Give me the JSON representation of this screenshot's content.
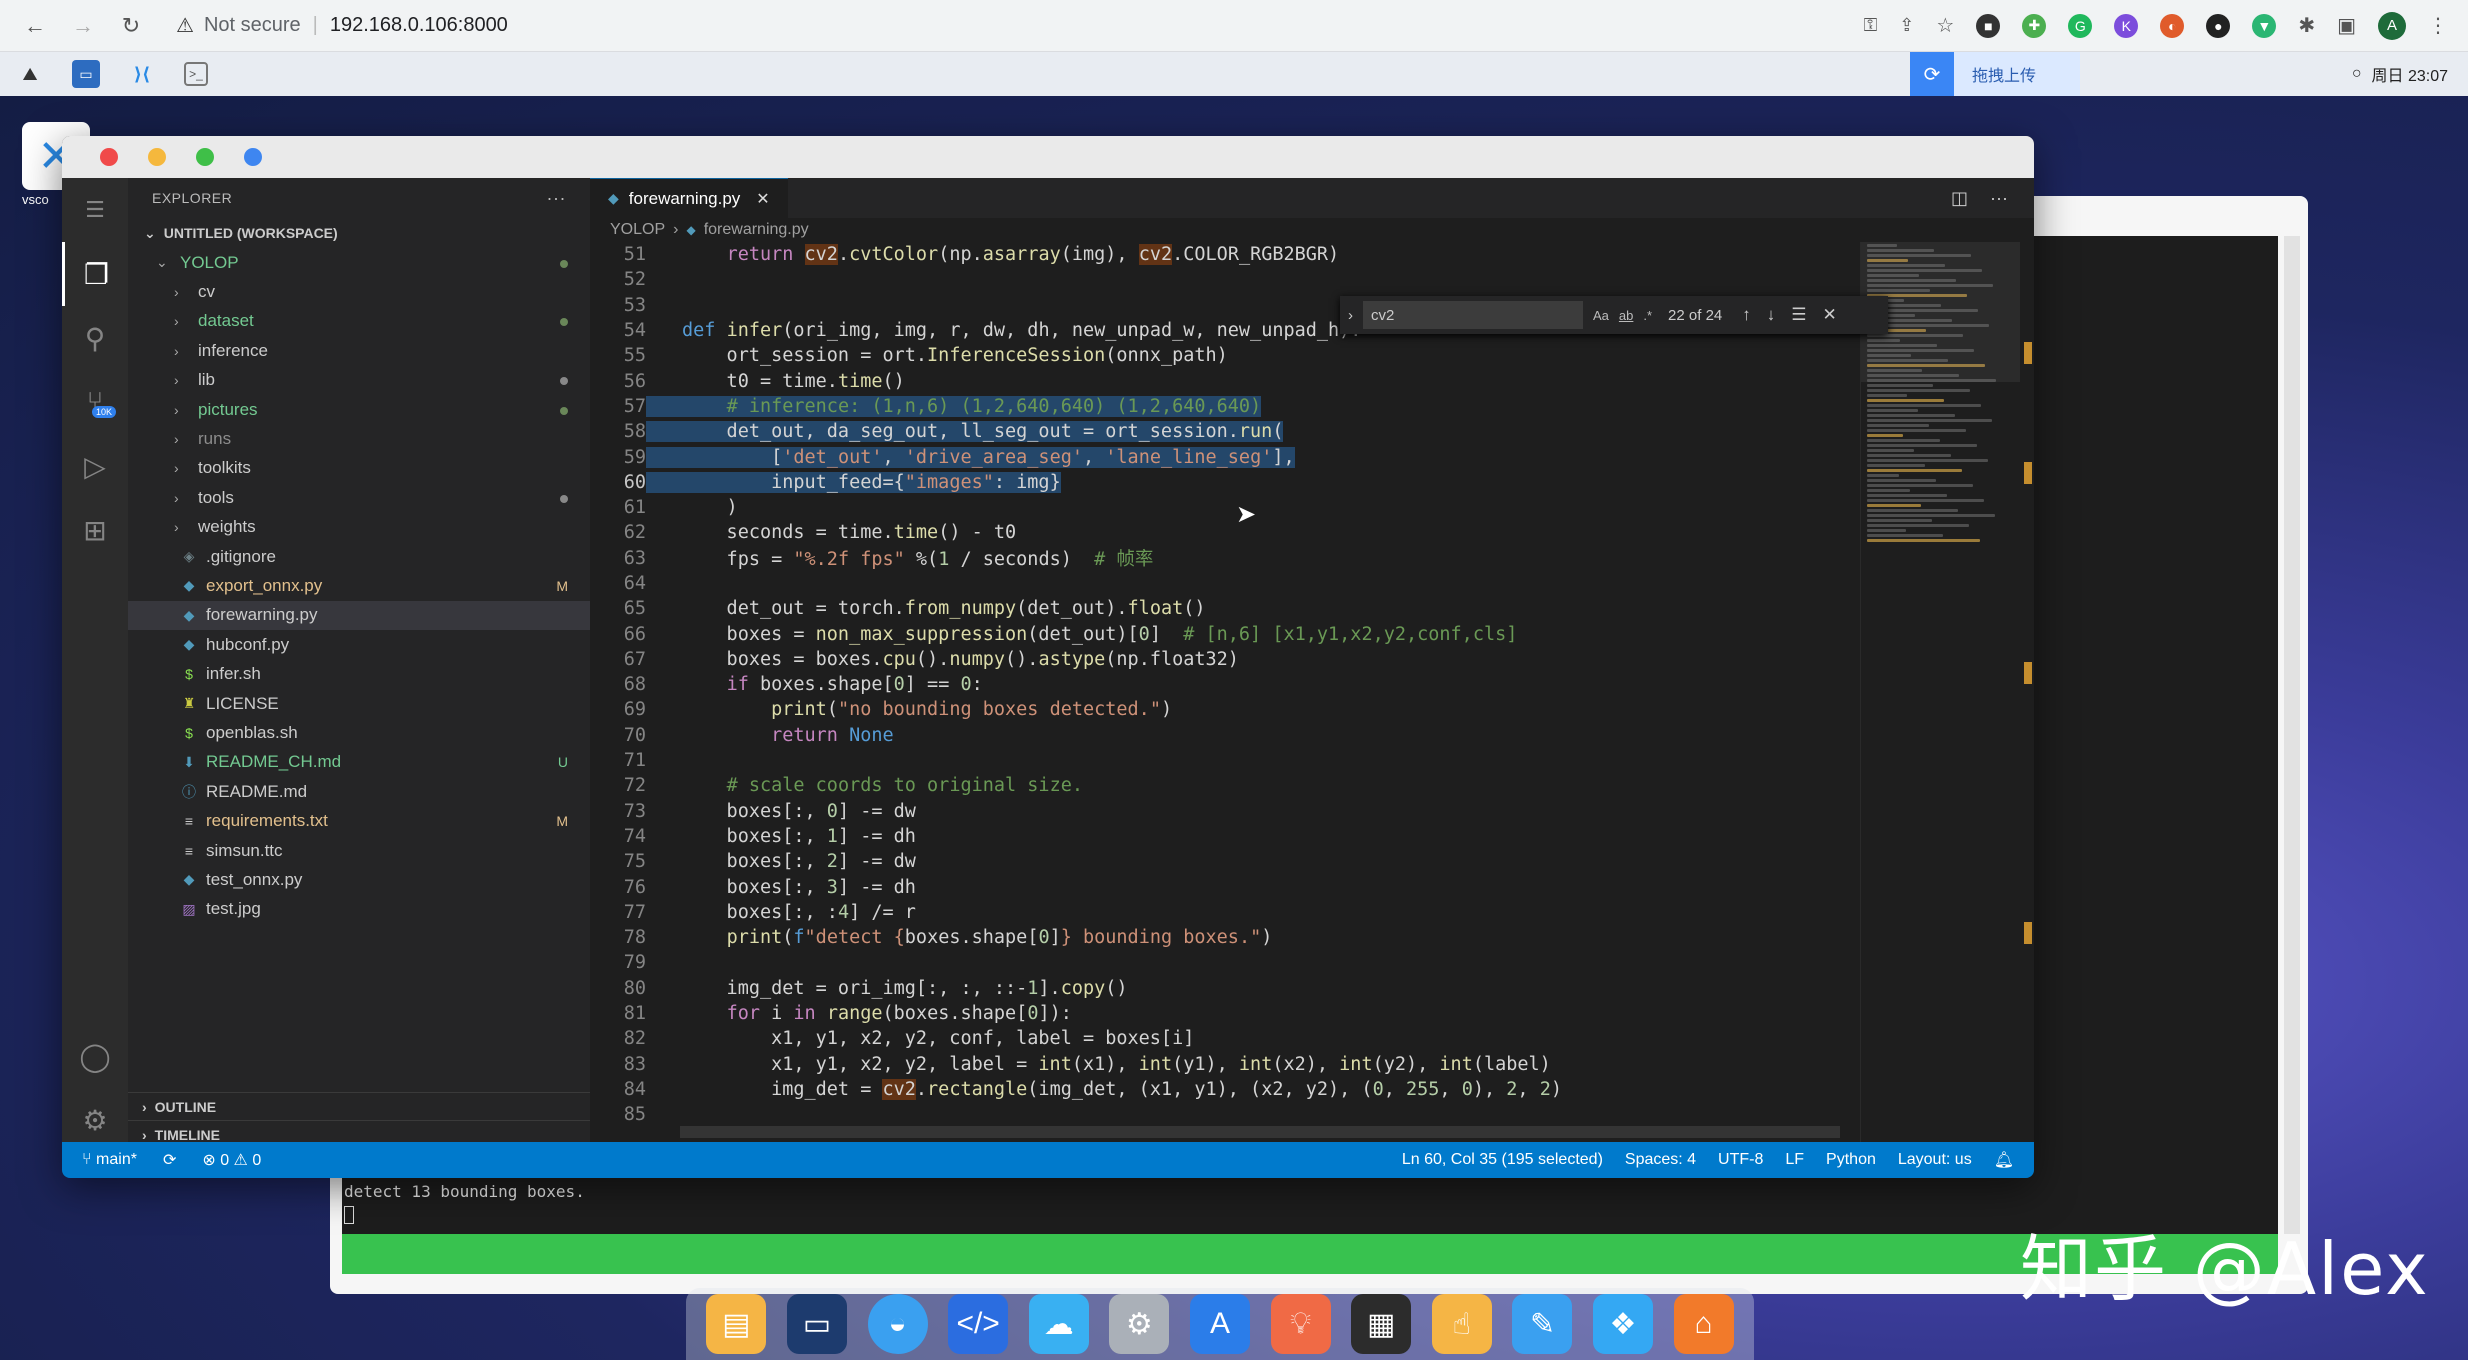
{
  "browser": {
    "security_label": "Not secure",
    "url": "192.168.0.106:8000",
    "avatar_letter": "A"
  },
  "desktop": {
    "upload_label": "拖拽上传",
    "clock": "周日 23:07",
    "vscode_icon_label": "vsco",
    "watermark": "知乎 @Alex"
  },
  "vscode": {
    "explorer_title": "EXPLORER",
    "workspace": "UNTITLED (WORKSPACE)",
    "root_folder": "YOLOP",
    "tree": [
      {
        "name": "cv",
        "type": "folder",
        "status": ""
      },
      {
        "name": "dataset",
        "type": "folder",
        "status": "dot",
        "color": "#73c991"
      },
      {
        "name": "inference",
        "type": "folder",
        "status": ""
      },
      {
        "name": "lib",
        "type": "folder",
        "status": "dotgray"
      },
      {
        "name": "pictures",
        "type": "folder",
        "status": "dot",
        "color": "#73c991"
      },
      {
        "name": "runs",
        "type": "folder",
        "status": "",
        "color": "#8c8c8c"
      },
      {
        "name": "toolkits",
        "type": "folder",
        "status": ""
      },
      {
        "name": "tools",
        "type": "folder",
        "status": "dotgray"
      },
      {
        "name": "weights",
        "type": "folder",
        "status": ""
      },
      {
        "name": ".gitignore",
        "type": "file",
        "icon": "◈",
        "icon_color": "#6d8086",
        "status": ""
      },
      {
        "name": "export_onnx.py",
        "type": "file",
        "icon": "◆",
        "icon_color": "#519aba",
        "status": "M",
        "color": "#e2c08d"
      },
      {
        "name": "forewarning.py",
        "type": "file",
        "icon": "◆",
        "icon_color": "#519aba",
        "status": "",
        "selected": true
      },
      {
        "name": "hubconf.py",
        "type": "file",
        "icon": "◆",
        "icon_color": "#519aba",
        "status": ""
      },
      {
        "name": "infer.sh",
        "type": "file",
        "icon": "$",
        "icon_color": "#89e051",
        "status": ""
      },
      {
        "name": "LICENSE",
        "type": "file",
        "icon": "♜",
        "icon_color": "#cbcb41",
        "status": ""
      },
      {
        "name": "openblas.sh",
        "type": "file",
        "icon": "$",
        "icon_color": "#89e051",
        "status": ""
      },
      {
        "name": "README_CH.md",
        "type": "file",
        "icon": "⬇",
        "icon_color": "#519aba",
        "status": "U",
        "color": "#73c991"
      },
      {
        "name": "README.md",
        "type": "file",
        "icon": "ⓘ",
        "icon_color": "#519aba",
        "status": ""
      },
      {
        "name": "requirements.txt",
        "type": "file",
        "icon": "≡",
        "icon_color": "#cccccc",
        "status": "M",
        "color": "#e2c08d"
      },
      {
        "name": "simsun.ttc",
        "type": "file",
        "icon": "≡",
        "icon_color": "#cccccc",
        "status": ""
      },
      {
        "name": "test_onnx.py",
        "type": "file",
        "icon": "◆",
        "icon_color": "#519aba",
        "status": ""
      },
      {
        "name": "test.jpg",
        "type": "file",
        "icon": "▨",
        "icon_color": "#a074c4",
        "status": ""
      }
    ],
    "outline_label": "OUTLINE",
    "timeline_label": "TIMELINE",
    "activity_badge": "10K",
    "tab_label": "forewarning.py",
    "breadcrumb_root": "YOLOP",
    "breadcrumb_file": "forewarning.py",
    "find": {
      "query": "cv2",
      "count": "22 of 24",
      "opt_case": "Aa",
      "opt_word": "ab",
      "opt_regex": ".*"
    },
    "code_lines": [
      {
        "n": "51",
        "html": "    <span class='ctl'>return</span> <span class='hl'>cv2</span>.<span class='fn'>cvtColor</span>(np.<span class='fn'>asarray</span>(img), <span class='hl'>cv2</span>.COLOR_RGB2BGR)"
      },
      {
        "n": "52",
        "html": ""
      },
      {
        "n": "53",
        "html": ""
      },
      {
        "n": "54",
        "html": "<span class='kw'>def</span> <span class='fn'>infer</span>(ori_img, img, r, dw, dh, new_unpad_w, new_unpad_h):"
      },
      {
        "n": "55",
        "html": "    ort_session = ort.<span class='fn'>InferenceSession</span>(onnx_path)"
      },
      {
        "n": "56",
        "html": "    t0 = time.<span class='fn'>time</span>()"
      },
      {
        "n": "57",
        "html": "    <span class='cm'># inference: (1,n,6) (1,2,640,640) (1,2,640,640)</span>",
        "sel": true
      },
      {
        "n": "58",
        "html": "    det_out, da_seg_out, ll_seg_out = ort_session.<span class='fn'>run</span>(",
        "sel": true
      },
      {
        "n": "59",
        "html": "        [<span class='str'>'det_out'</span>, <span class='str'>'drive_area_seg'</span>, <span class='str'>'lane_line_seg'</span>],",
        "sel": true
      },
      {
        "n": "60",
        "html": "        input_feed={<span class='str'>\"images\"</span>: img}",
        "sel": true,
        "cur": true
      },
      {
        "n": "61",
        "html": "    )"
      },
      {
        "n": "62",
        "html": "    seconds = time.<span class='fn'>time</span>() - t0"
      },
      {
        "n": "63",
        "html": "    fps = <span class='str'>\"%.2f fps\"</span> %(<span class='num'>1</span> / seconds)  <span class='cm'># 帧率</span>"
      },
      {
        "n": "64",
        "html": ""
      },
      {
        "n": "65",
        "html": "    det_out = torch.<span class='fn'>from_numpy</span>(det_out).<span class='fn'>float</span>()"
      },
      {
        "n": "66",
        "html": "    boxes = <span class='fn'>non_max_suppression</span>(det_out)[<span class='num'>0</span>]  <span class='cm'># [n,6] [x1,y1,x2,y2,conf,cls]</span>"
      },
      {
        "n": "67",
        "html": "    boxes = boxes.<span class='fn'>cpu</span>().<span class='fn'>numpy</span>().<span class='fn'>astype</span>(np.float32)"
      },
      {
        "n": "68",
        "html": "    <span class='ctl'>if</span> boxes.shape[<span class='num'>0</span>] == <span class='num'>0</span>:"
      },
      {
        "n": "69",
        "html": "        <span class='fn'>print</span>(<span class='str'>\"no bounding boxes detected.\"</span>)"
      },
      {
        "n": "70",
        "html": "        <span class='ctl'>return</span> <span class='kw'>None</span>"
      },
      {
        "n": "71",
        "html": ""
      },
      {
        "n": "72",
        "html": "    <span class='cm'># scale coords to original size.</span>"
      },
      {
        "n": "73",
        "html": "    boxes[:, <span class='num'>0</span>] -= dw"
      },
      {
        "n": "74",
        "html": "    boxes[:, <span class='num'>1</span>] -= dh"
      },
      {
        "n": "75",
        "html": "    boxes[:, <span class='num'>2</span>] -= dw"
      },
      {
        "n": "76",
        "html": "    boxes[:, <span class='num'>3</span>] -= dh"
      },
      {
        "n": "77",
        "html": "    boxes[:, :<span class='num'>4</span>] /= r"
      },
      {
        "n": "78",
        "html": "    <span class='fn'>print</span>(<span class='kw'>f</span><span class='str'>\"detect {</span>boxes.shape[<span class='num'>0</span>]<span class='str'>} bounding boxes.\"</span>)"
      },
      {
        "n": "79",
        "html": ""
      },
      {
        "n": "80",
        "html": "    img_det = ori_img[:, :, ::-<span class='num'>1</span>].<span class='fn'>copy</span>()"
      },
      {
        "n": "81",
        "html": "    <span class='ctl'>for</span> i <span class='ctl'>in</span> <span class='fn'>range</span>(boxes.shape[<span class='num'>0</span>]):"
      },
      {
        "n": "82",
        "html": "        x1, y1, x2, y2, conf, label = boxes[i]"
      },
      {
        "n": "83",
        "html": "        x1, y1, x2, y2, label = <span class='fn'>int</span>(x1), <span class='fn'>int</span>(y1), <span class='fn'>int</span>(x2), <span class='fn'>int</span>(y2), <span class='fn'>int</span>(label)"
      },
      {
        "n": "84",
        "html": "        img_det = <span class='hl'>cv2</span>.<span class='fn'>rectangle</span>(img_det, (x1, y1), (x2, y2), (<span class='num'>0</span>, <span class='num'>255</span>, <span class='num'>0</span>), <span class='num'>2</span>, <span class='num'>2</span>)"
      },
      {
        "n": "85",
        "html": ""
      }
    ],
    "status": {
      "branch": "main*",
      "problems": "⊗ 0 ⚠ 0",
      "position": "Ln 60, Col 35 (195 selected)",
      "spaces": "Spaces: 4",
      "encoding": "UTF-8",
      "eol": "LF",
      "language": "Python",
      "layout": "Layout: us"
    }
  },
  "terminal": {
    "last_line": "detect 13 bounding boxes."
  }
}
